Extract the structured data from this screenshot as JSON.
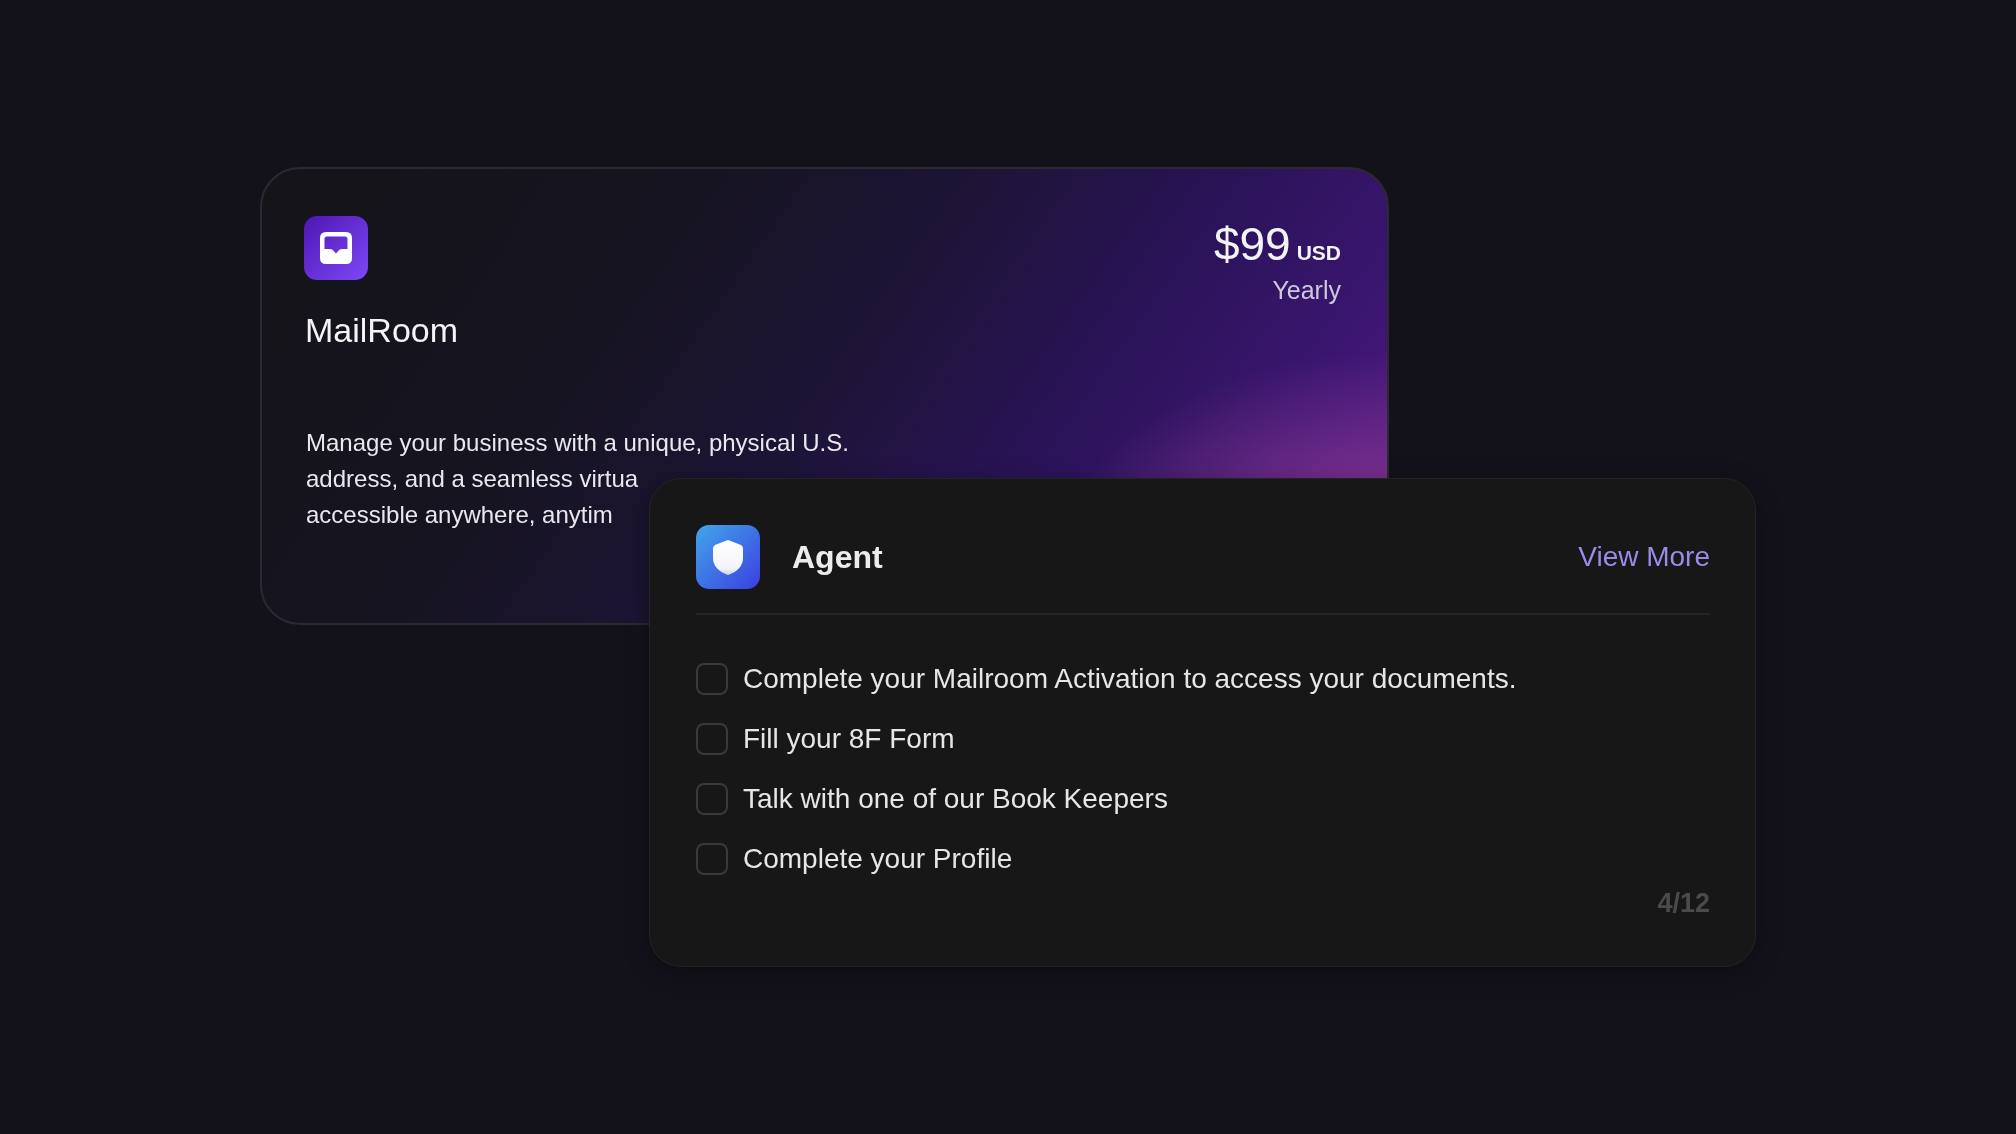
{
  "product_card": {
    "title": "MailRoom",
    "price": {
      "amount": "$99",
      "currency": "USD",
      "period": "Yearly"
    },
    "description_lines": [
      "Manage your business with a unique, physical U.S.",
      "address, and a seamless virtua",
      "accessible anywhere, anytim"
    ]
  },
  "checklist_card": {
    "title": "Agent",
    "link": "View More",
    "items": [
      {
        "label": "Complete your Mailroom Activation to access your documents.",
        "checked": false
      },
      {
        "label": "Fill your 8F Form",
        "checked": false
      },
      {
        "label": "Talk with one of our Book Keepers",
        "checked": false
      },
      {
        "label": "Complete your Profile",
        "checked": false
      }
    ],
    "progress": "4/12"
  }
}
